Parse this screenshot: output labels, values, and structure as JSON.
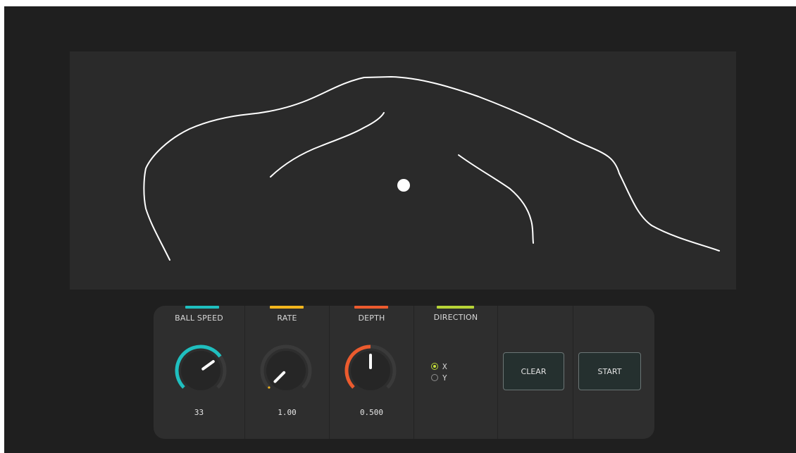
{
  "controls": {
    "ball_speed": {
      "label": "BALL SPEED",
      "value": "33",
      "fraction": 0.7,
      "color": "#1fbfbf"
    },
    "rate": {
      "label": "RATE",
      "value": "1.00",
      "fraction": 0.0,
      "color": "#f2b51d"
    },
    "depth": {
      "label": "DEPTH",
      "value": "0.500",
      "fraction": 0.5,
      "color": "#ec5b2e"
    },
    "direction": {
      "label": "DIRECTION",
      "color": "#b7d437",
      "options": [
        {
          "label": "X",
          "selected": true
        },
        {
          "label": "Y",
          "selected": false
        }
      ]
    }
  },
  "buttons": {
    "clear_label": "CLEAR",
    "start_label": "START"
  },
  "colors": {
    "background": "#1f1f1f",
    "canvas": "#2a2a2a",
    "panel": "#2e2e2e",
    "knob_track": "#3a3a3a",
    "knob_body": "#262626",
    "stroke": "#ffffff"
  }
}
